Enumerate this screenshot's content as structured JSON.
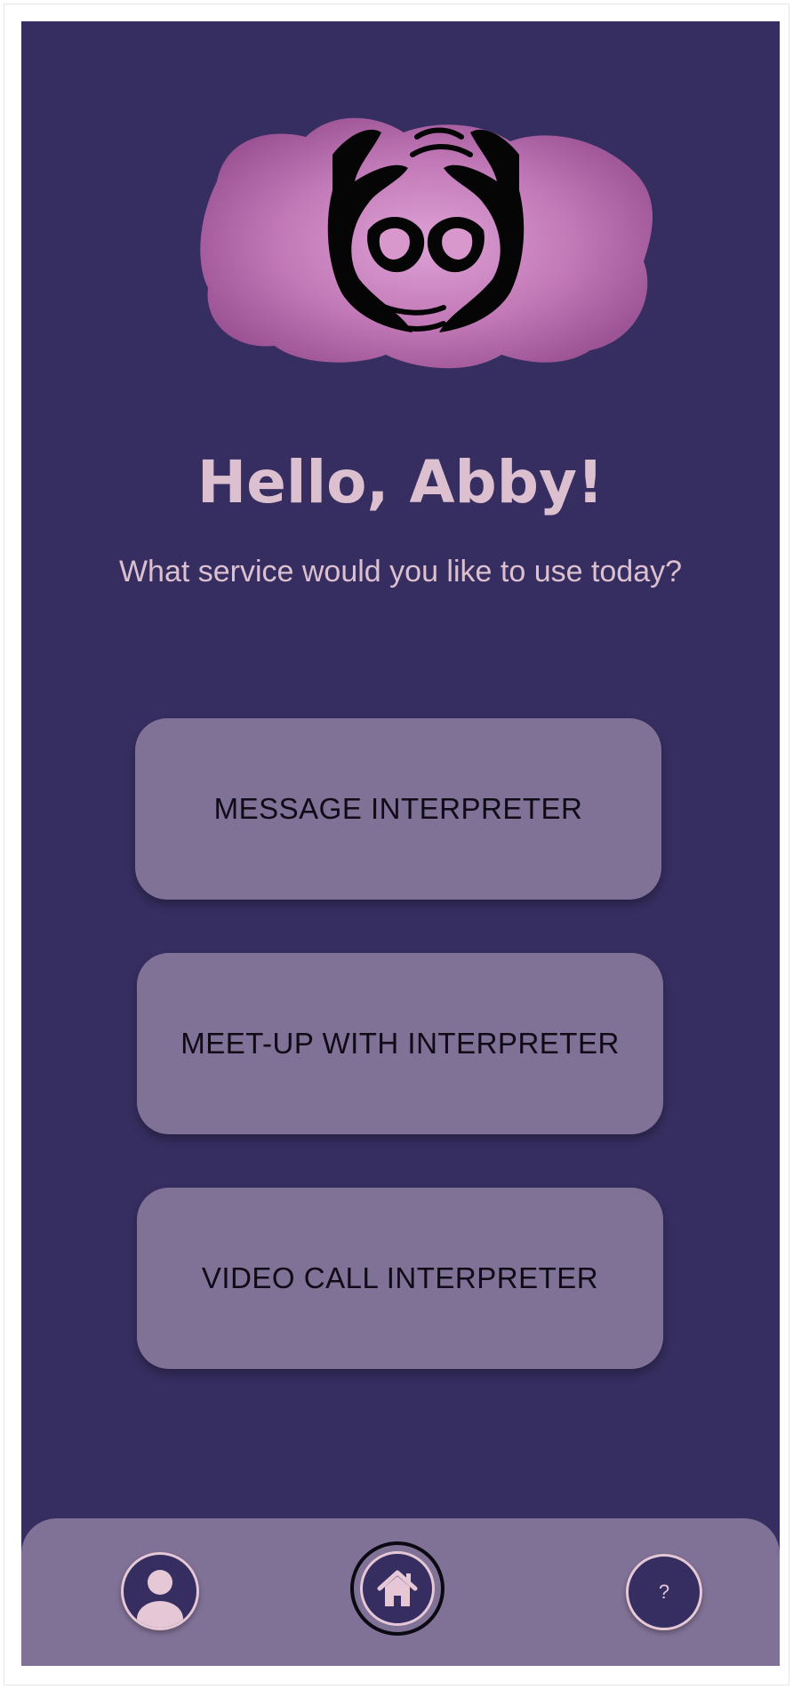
{
  "app": {
    "greeting": "Hello, Abby!",
    "subtitle": "What service would you like to use today?"
  },
  "services": [
    {
      "label": "MESSAGE INTERPRETER"
    },
    {
      "label": "MEET-UP WITH INTERPRETER"
    },
    {
      "label": "VIDEO CALL INTERPRETER"
    }
  ],
  "nav": {
    "profile_icon": "profile-icon",
    "home_icon": "home-icon",
    "help_label": "?"
  },
  "colors": {
    "background": "#362e60",
    "button": "#807196",
    "accent_pink": "#ddc0d0",
    "logo_purple": "#c77dba"
  }
}
